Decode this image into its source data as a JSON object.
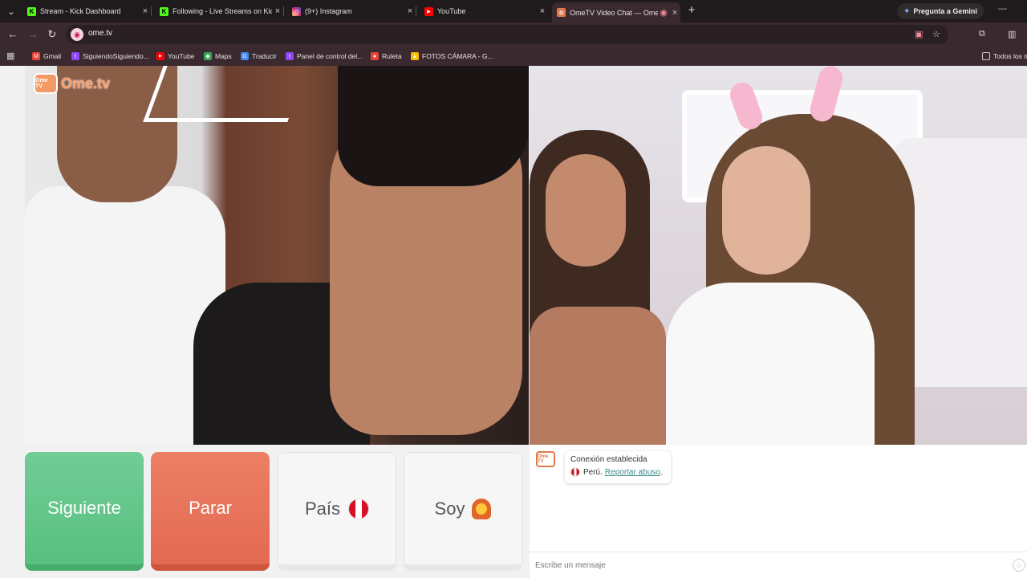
{
  "browser": {
    "tabs": [
      {
        "title": "Stream - Kick Dashboard",
        "favicon": "kick-icon",
        "color": "#53fc18",
        "letter": "K"
      },
      {
        "title": "Following - Live Streams on Kick",
        "favicon": "kick-icon",
        "color": "#53fc18",
        "letter": "K"
      },
      {
        "title": "(9+) Instagram",
        "favicon": "instagram-icon",
        "color": "#d62976",
        "letter": "◎"
      },
      {
        "title": "YouTube",
        "favicon": "youtube-icon",
        "color": "#ff0000",
        "letter": "▶"
      },
      {
        "title": "OmeTV Video Chat — Ome",
        "favicon": "ometv-icon",
        "color": "#e07a4a",
        "letter": "ᴏ"
      }
    ],
    "gemini_label": "Pregunta a Gemini",
    "url": "ome.tv",
    "bookmarks": [
      {
        "label": "Gmail",
        "color": "#ea4335",
        "letter": "M"
      },
      {
        "label": "SiguiendoSiguiendo...",
        "color": "#9146ff",
        "letter": "t"
      },
      {
        "label": "YouTube",
        "color": "#ff0000",
        "letter": "▶"
      },
      {
        "label": "Maps",
        "color": "#34a853",
        "letter": "◆"
      },
      {
        "label": "Traducir",
        "color": "#4285f4",
        "letter": "G"
      },
      {
        "label": "Panel de control del...",
        "color": "#9146ff",
        "letter": "t"
      },
      {
        "label": "Ruleta",
        "color": "#ea4335",
        "letter": "●"
      },
      {
        "label": "FOTOS CÁMARA - G...",
        "color": "#fbbc04",
        "letter": "▲"
      }
    ],
    "all_bookmarks": "Todos los m"
  },
  "ometv": {
    "logo_text": "Ome.tv",
    "logo_badge": "Ome TV",
    "buttons": {
      "next": "Siguiente",
      "stop": "Parar",
      "country": "País",
      "gender": "Soy"
    },
    "chat": {
      "status": "Conexión establecida",
      "country": "Perú.",
      "report": "Reportar abuso",
      "report_suffix": ".",
      "placeholder": "Escribe un mensaje"
    }
  }
}
